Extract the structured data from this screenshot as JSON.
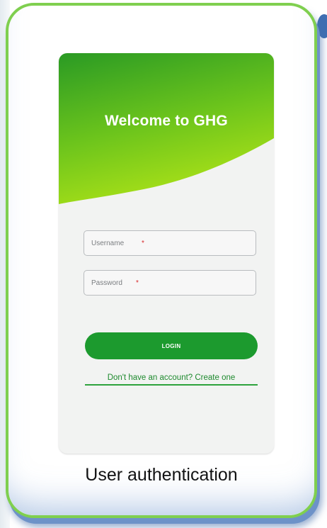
{
  "app": {
    "welcome_title": "Welcome to GHG"
  },
  "form": {
    "username_placeholder": "Username",
    "password_placeholder": "Password",
    "required_marker": "*",
    "login_label": "LOGIN",
    "signup_link": "Don't have an account? Create one"
  },
  "caption": "User authentication",
  "colors": {
    "card_border": "#7fcf4f",
    "card_shadow": "#6d92c8",
    "hero_gradient_top": "#2a9a24",
    "hero_gradient_bottom": "#a8e018",
    "login_button": "#1c9a2e",
    "link": "#1e8a2e",
    "required": "#d8282a"
  }
}
